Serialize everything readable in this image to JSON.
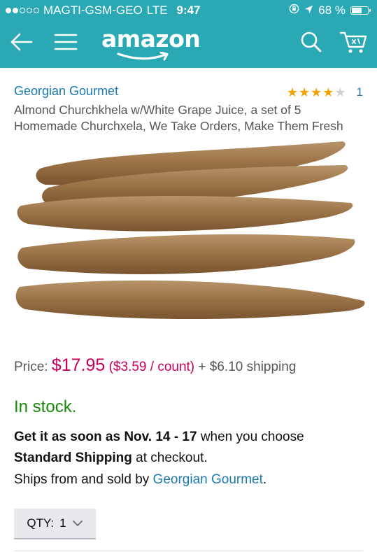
{
  "status_bar": {
    "carrier": "MAGTI-GSM-GEO",
    "network": "LTE",
    "time": "9:47",
    "battery_percent": "68 %",
    "signal_bars_filled": 2,
    "battery_level": 0.68
  },
  "app_bar": {
    "logo_text": "amazon",
    "back_icon": "arrow-left-icon",
    "menu_icon": "hamburger-menu-icon",
    "search_icon": "search-icon",
    "cart_icon": "cart-icon"
  },
  "product": {
    "seller": "Georgian Gourmet",
    "rating_stars": 4,
    "rating_max": 5,
    "review_count": "1",
    "title": "Almond Churchkhela w/White Grape Juice, a set of 5 Homemade Churchxela, We Take Orders, Make Them Fresh"
  },
  "pricing": {
    "label": "Price:",
    "amount": "$17.95",
    "unit_price": "($3.59 / count)",
    "shipping": "+ $6.10 shipping"
  },
  "availability": {
    "status": "In stock.",
    "delivery_prefix": "Get it as soon as",
    "delivery_dates": "Nov. 14 - 17",
    "delivery_middle": "when you choose",
    "shipping_method": "Standard Shipping",
    "delivery_suffix": "at checkout.",
    "ships_prefix": "Ships from and sold by",
    "ships_seller": "Georgian Gourmet",
    "ships_suffix": "."
  },
  "quantity": {
    "label": "QTY:",
    "value": "1"
  },
  "colors": {
    "header_bg": "#2aa8b4",
    "link": "#1a7ab3",
    "price": "#c4005a",
    "in_stock": "#1a8a0a",
    "star": "#f2a100"
  }
}
